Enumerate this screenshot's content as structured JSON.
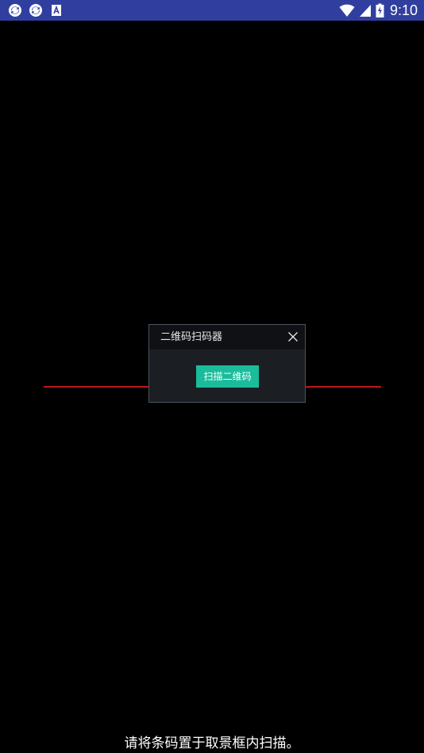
{
  "status_bar": {
    "time": "9:10",
    "background": "#303f9f",
    "left_icons": [
      "sync-icon",
      "sync-icon",
      "font-a-icon"
    ],
    "right_icons": [
      "wifi-icon",
      "signal-icon",
      "battery-charging-icon"
    ]
  },
  "dialog": {
    "title": "二维码扫码器",
    "button_label": "扫描二维码",
    "close_icon": "close-icon",
    "button_color": "#1abc9c"
  },
  "scanner": {
    "line_color": "#c0151c",
    "hint": "请将条码置于取景框内扫描。"
  }
}
